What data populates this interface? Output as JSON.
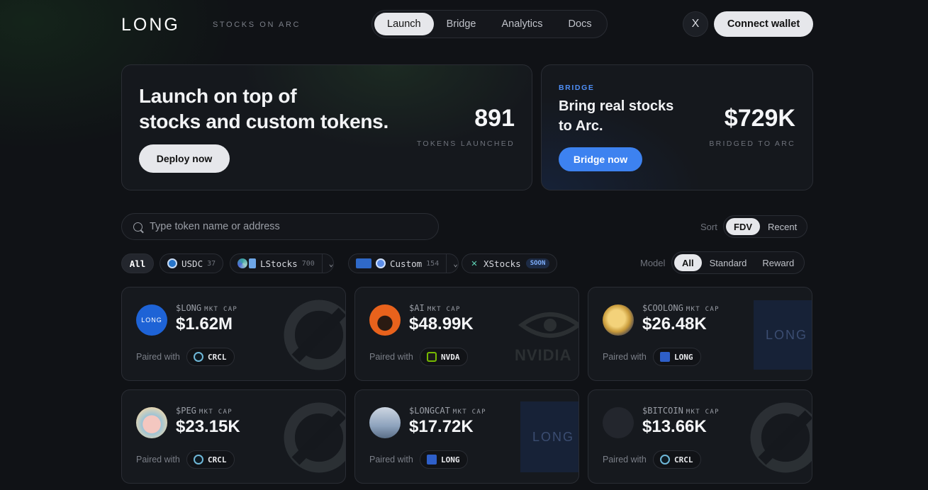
{
  "header": {
    "logo": "LONG",
    "tagline": "STOCKS ON ARC",
    "nav": [
      {
        "label": "Launch",
        "active": true
      },
      {
        "label": "Bridge",
        "active": false
      },
      {
        "label": "Analytics",
        "active": false
      },
      {
        "label": "Docs",
        "active": false
      }
    ],
    "x_icon": "X",
    "connect_label": "Connect wallet"
  },
  "hero_launch": {
    "title_line1": "Launch on top of",
    "title_line2": "stocks and custom tokens.",
    "button": "Deploy now",
    "stat_value": "891",
    "stat_label": "TOKENS LAUNCHED"
  },
  "hero_bridge": {
    "tag": "BRIDGE",
    "title_line1": "Bring real stocks",
    "title_line2": "to Arc.",
    "button": "Bridge now",
    "stat_value": "$729K",
    "stat_label": "BRIDGED TO ARC"
  },
  "search": {
    "placeholder": "Type token name or address"
  },
  "sort": {
    "label": "Sort",
    "options": [
      "FDV",
      "Recent"
    ],
    "active": "FDV"
  },
  "model": {
    "label": "Model",
    "options": [
      "All",
      "Standard",
      "Reward"
    ],
    "active": "All"
  },
  "filters": {
    "all": "All",
    "usdc": {
      "label": "USDC",
      "count": "37"
    },
    "lstocks": {
      "label": "LStocks",
      "count": "700"
    },
    "custom": {
      "label": "Custom",
      "count": "154"
    },
    "xstocks": {
      "label": "XStocks",
      "badge": "SOON"
    }
  },
  "tokens": [
    {
      "ticker": "$LONG",
      "mkt_label": "MKT CAP",
      "mcap": "$1.62M",
      "paired_label": "Paired with",
      "pair": "CRCL"
    },
    {
      "ticker": "$AI",
      "mkt_label": "MKT CAP",
      "mcap": "$48.99K",
      "paired_label": "Paired with",
      "pair": "NVDA"
    },
    {
      "ticker": "$COOLONG",
      "mkt_label": "MKT CAP",
      "mcap": "$26.48K",
      "paired_label": "Paired with",
      "pair": "LONG"
    },
    {
      "ticker": "$PEG",
      "mkt_label": "MKT CAP",
      "mcap": "$23.15K",
      "paired_label": "Paired with",
      "pair": "CRCL"
    },
    {
      "ticker": "$LONGCAT",
      "mkt_label": "MKT CAP",
      "mcap": "$17.72K",
      "paired_label": "Paired with",
      "pair": "LONG"
    },
    {
      "ticker": "$BITCOIN",
      "mkt_label": "MKT CAP",
      "mcap": "$13.66K",
      "paired_label": "Paired with",
      "pair": "CRCL"
    }
  ],
  "avatar_logo_text": "LONG",
  "watermark_text_nvidia": "NVIDIA",
  "watermark_text_long": "LONG",
  "colors": {
    "accent_blue": "#3d82f0",
    "bg": "#101216",
    "card": "#16191e"
  }
}
